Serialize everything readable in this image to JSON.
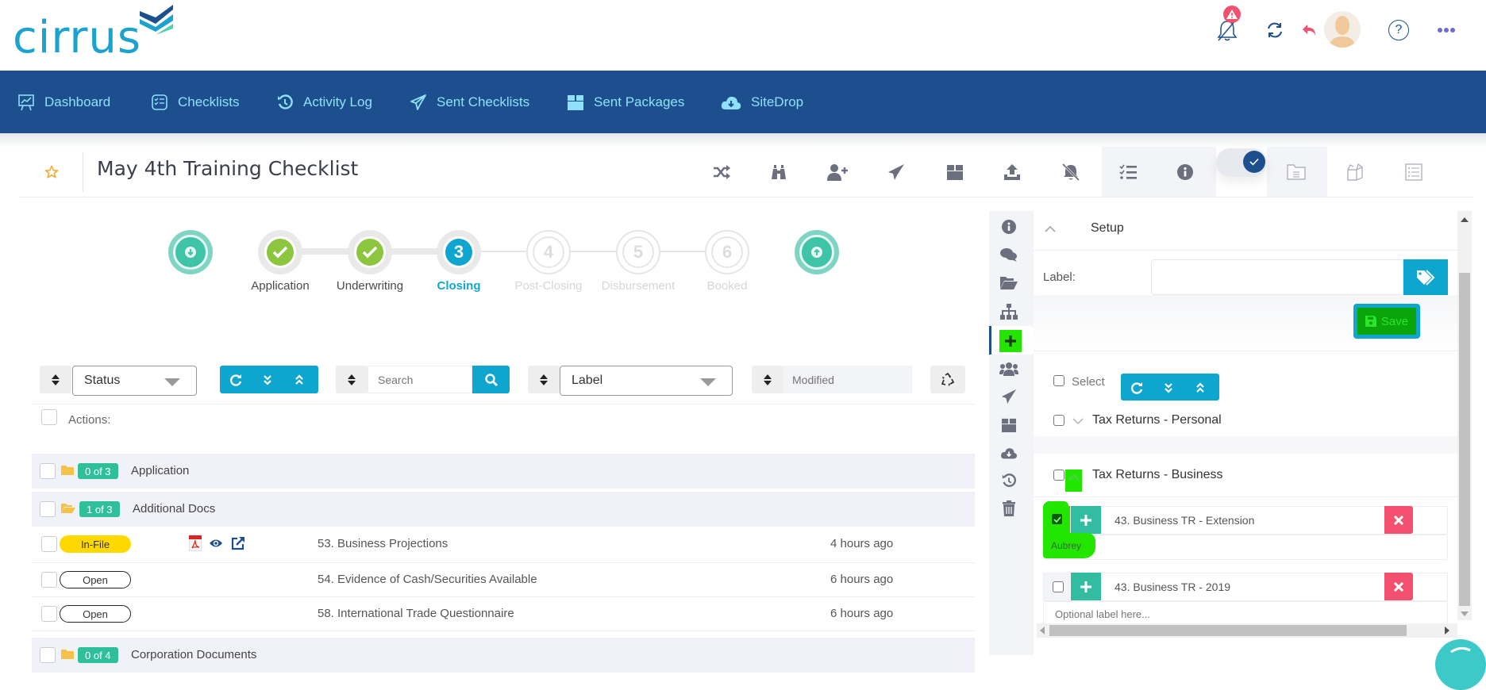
{
  "app": {
    "logo_text": "cirrus"
  },
  "topbar": {
    "icons": [
      "bell-off-icon",
      "refresh-icon",
      "undo-icon",
      "avatar",
      "help-icon",
      "more-icon"
    ],
    "alert_badge": "!",
    "help_glyph": "?"
  },
  "nav": {
    "items": [
      {
        "label": "Dashboard",
        "icon": "dashboard-icon"
      },
      {
        "label": "Checklists",
        "icon": "checklist-icon"
      },
      {
        "label": "Activity Log",
        "icon": "history-icon"
      },
      {
        "label": "Sent Checklists",
        "icon": "paper-plane-icon"
      },
      {
        "label": "Sent Packages",
        "icon": "box-icon"
      },
      {
        "label": "SiteDrop",
        "icon": "cloud-download-icon"
      }
    ]
  },
  "page": {
    "title": "May 4th Training Checklist",
    "toolbar_icons": [
      "shuffle-icon",
      "binoculars-icon",
      "add-user-icon",
      "send-icon",
      "box-icon",
      "upload-icon",
      "bell-slash-icon",
      "tasks-icon",
      "info-icon",
      "toggle",
      "folder-doc-icon",
      "open-box-icon",
      "list-icon"
    ],
    "toggle_on": true
  },
  "stepper": {
    "steps": [
      {
        "num": "",
        "label": "Application",
        "state": "done"
      },
      {
        "num": "",
        "label": "Underwriting",
        "state": "done"
      },
      {
        "num": "3",
        "label": "Closing",
        "state": "current"
      },
      {
        "num": "4",
        "label": "Post-Closing",
        "state": "pending"
      },
      {
        "num": "5",
        "label": "Disbursement",
        "state": "pending"
      },
      {
        "num": "6",
        "label": "Booked",
        "state": "pending"
      }
    ]
  },
  "filters": {
    "status_select": "Status",
    "search_placeholder": "Search",
    "label_select": "Label",
    "modified_placeholder": "Modified",
    "actions_label": "Actions:"
  },
  "list": {
    "groups": [
      {
        "count": "0 of 3",
        "title": "Application",
        "folder": "closed"
      },
      {
        "count": "1 of 3",
        "title": "Additional Docs",
        "folder": "open",
        "items": [
          {
            "status": "In-File",
            "name": "53. Business Projections",
            "time": "4 hours ago",
            "has_file": true
          },
          {
            "status": "Open",
            "name": "54. Evidence of Cash/Securities Available",
            "time": "6 hours ago",
            "has_file": false
          },
          {
            "status": "Open",
            "name": "58. International Trade Questionnaire",
            "time": "6 hours ago",
            "has_file": false
          }
        ]
      },
      {
        "count": "0 of 4",
        "title": "Corporation Documents",
        "folder": "closed"
      }
    ]
  },
  "rail": {
    "icons": [
      "info-icon",
      "comments-icon",
      "folder-open-icon",
      "sitemap-icon",
      "plus-icon",
      "users-icon",
      "send-icon",
      "box-icon",
      "cloud-download-icon",
      "history-icon",
      "trash-icon"
    ],
    "active": "plus-icon"
  },
  "setup": {
    "title": "Setup",
    "label_field_label": "Label:",
    "label_field_value": "",
    "save_label": "Save",
    "select_label": "Select",
    "groups": [
      {
        "title": "Tax Returns - Personal",
        "expanded": false
      },
      {
        "title": "Tax Returns - Business",
        "expanded": true
      }
    ],
    "docs": [
      {
        "name": "43. Business TR - Extension",
        "checked": true,
        "label_value": "Aubrey",
        "label_placeholder": "Optional label here..."
      },
      {
        "name": "43. Business TR - 2019",
        "checked": false,
        "label_value": "",
        "label_placeholder": "Optional label here..."
      }
    ]
  }
}
